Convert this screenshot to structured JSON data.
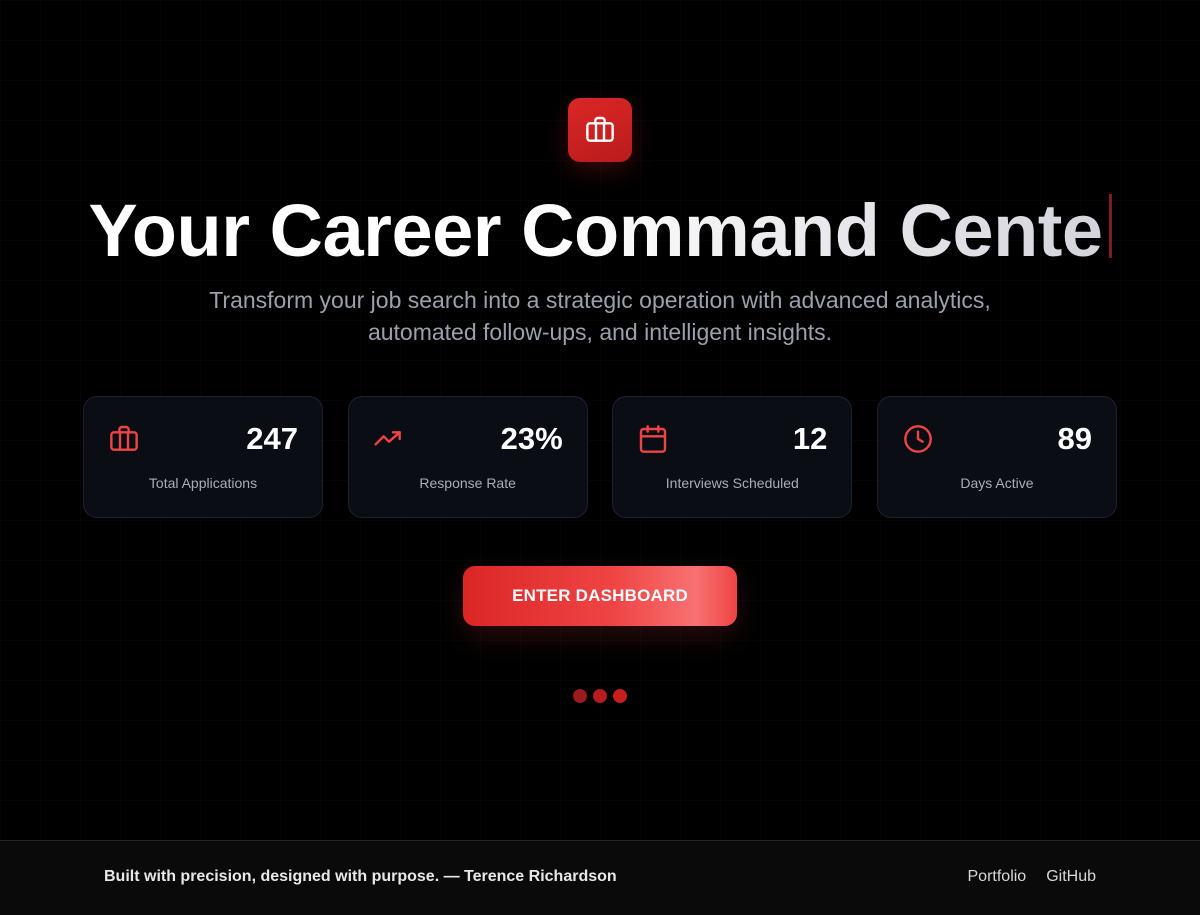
{
  "hero": {
    "logo_icon": "briefcase-icon",
    "headline": "Your Career Command Cente",
    "subtitle": "Transform your job search into a strategic operation with advanced analytics, automated follow-ups, and intelligent insights."
  },
  "stats": [
    {
      "icon": "briefcase-icon",
      "value": "247",
      "label": "Total Applications"
    },
    {
      "icon": "trending-up-icon",
      "value": "23%",
      "label": "Response Rate"
    },
    {
      "icon": "calendar-icon",
      "value": "12",
      "label": "Interviews Scheduled"
    },
    {
      "icon": "clock-icon",
      "value": "89",
      "label": "Days Active"
    }
  ],
  "cta": {
    "label": "ENTER DASHBOARD"
  },
  "loading_dots": {
    "count": 3,
    "colors": [
      "#991b1b",
      "#b91c1c",
      "#c81e1e"
    ]
  },
  "footer": {
    "credit": "Built with precision, designed with purpose. — Terence Richardson",
    "links": [
      "Portfolio",
      "GitHub"
    ]
  },
  "colors": {
    "accent": "#ef4444",
    "accent_dark": "#dc2626",
    "background": "#000000",
    "card_bg": "#0b0d14",
    "card_border": "#1e2230",
    "subtitle_text": "#9aa0ac",
    "footer_bg": "#0a0a0a"
  }
}
